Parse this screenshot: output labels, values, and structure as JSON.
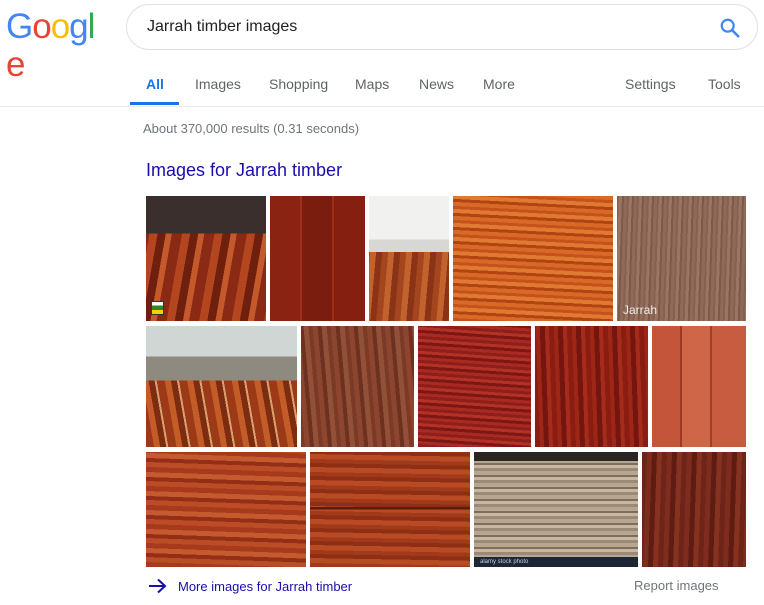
{
  "logo": {
    "letters": [
      {
        "char": "G",
        "color": "#4285F4"
      },
      {
        "char": "o",
        "color": "#EA4335"
      },
      {
        "char": "o",
        "color": "#FBBC05"
      },
      {
        "char": "g",
        "color": "#4285F4"
      },
      {
        "char": "l",
        "color": "#34A853"
      },
      {
        "char": "e",
        "color": "#EA4335"
      }
    ]
  },
  "search": {
    "query": "Jarrah timber images",
    "icon": "search-icon",
    "icon_color": "#4285F4"
  },
  "tabs": {
    "all": "All",
    "images": "Images",
    "shopping": "Shopping",
    "maps": "Maps",
    "news": "News",
    "more": "More",
    "settings": "Settings",
    "tools": "Tools",
    "active": "All"
  },
  "results": {
    "stats": "About 370,000 results (0.31 seconds)"
  },
  "images_section": {
    "heading": "Images for Jarrah timber",
    "thumb_labels": {
      "jarrah": "Jarrah",
      "stock": "alamy stock photo"
    },
    "more_link": "More images for Jarrah timber",
    "report": "Report images"
  },
  "colors": {
    "link": "#1a0dab",
    "accent": "#1a73e8",
    "muted": "#70757a"
  }
}
